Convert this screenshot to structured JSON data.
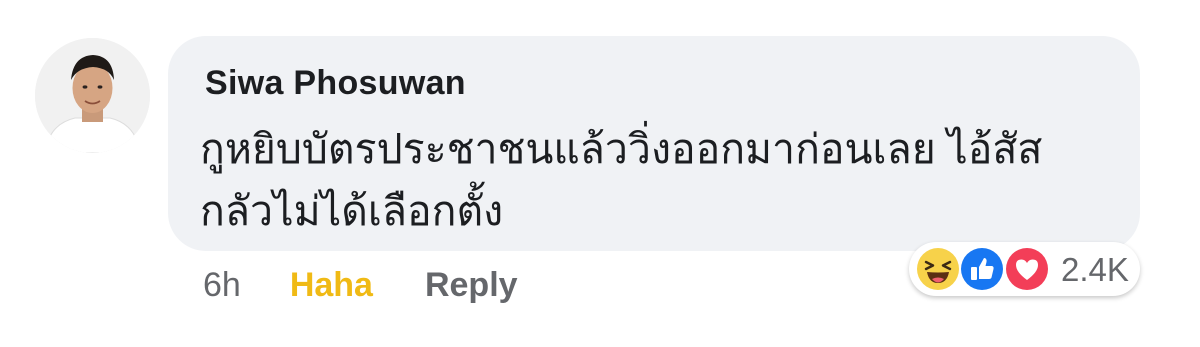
{
  "comment": {
    "author": "Siwa Phosuwan",
    "text_line1": "กูหยิบบัตรประชาชนแล้ววิ่งออกมาก่อนเลย ไอ้สัส",
    "text_line2": "กลัวไม่ได้เลือกตั้ง"
  },
  "actions": {
    "time": "6h",
    "reaction_label": "Haha",
    "reply_label": "Reply"
  },
  "reactions": {
    "icons": [
      "haha-icon",
      "like-icon",
      "love-icon"
    ],
    "count": "2.4K"
  },
  "colors": {
    "bubble": "#f0f2f5",
    "haha_active": "#f0ba15",
    "like_blue": "#1877f2",
    "love_red": "#f33e58",
    "meta_gray": "#65676b"
  }
}
